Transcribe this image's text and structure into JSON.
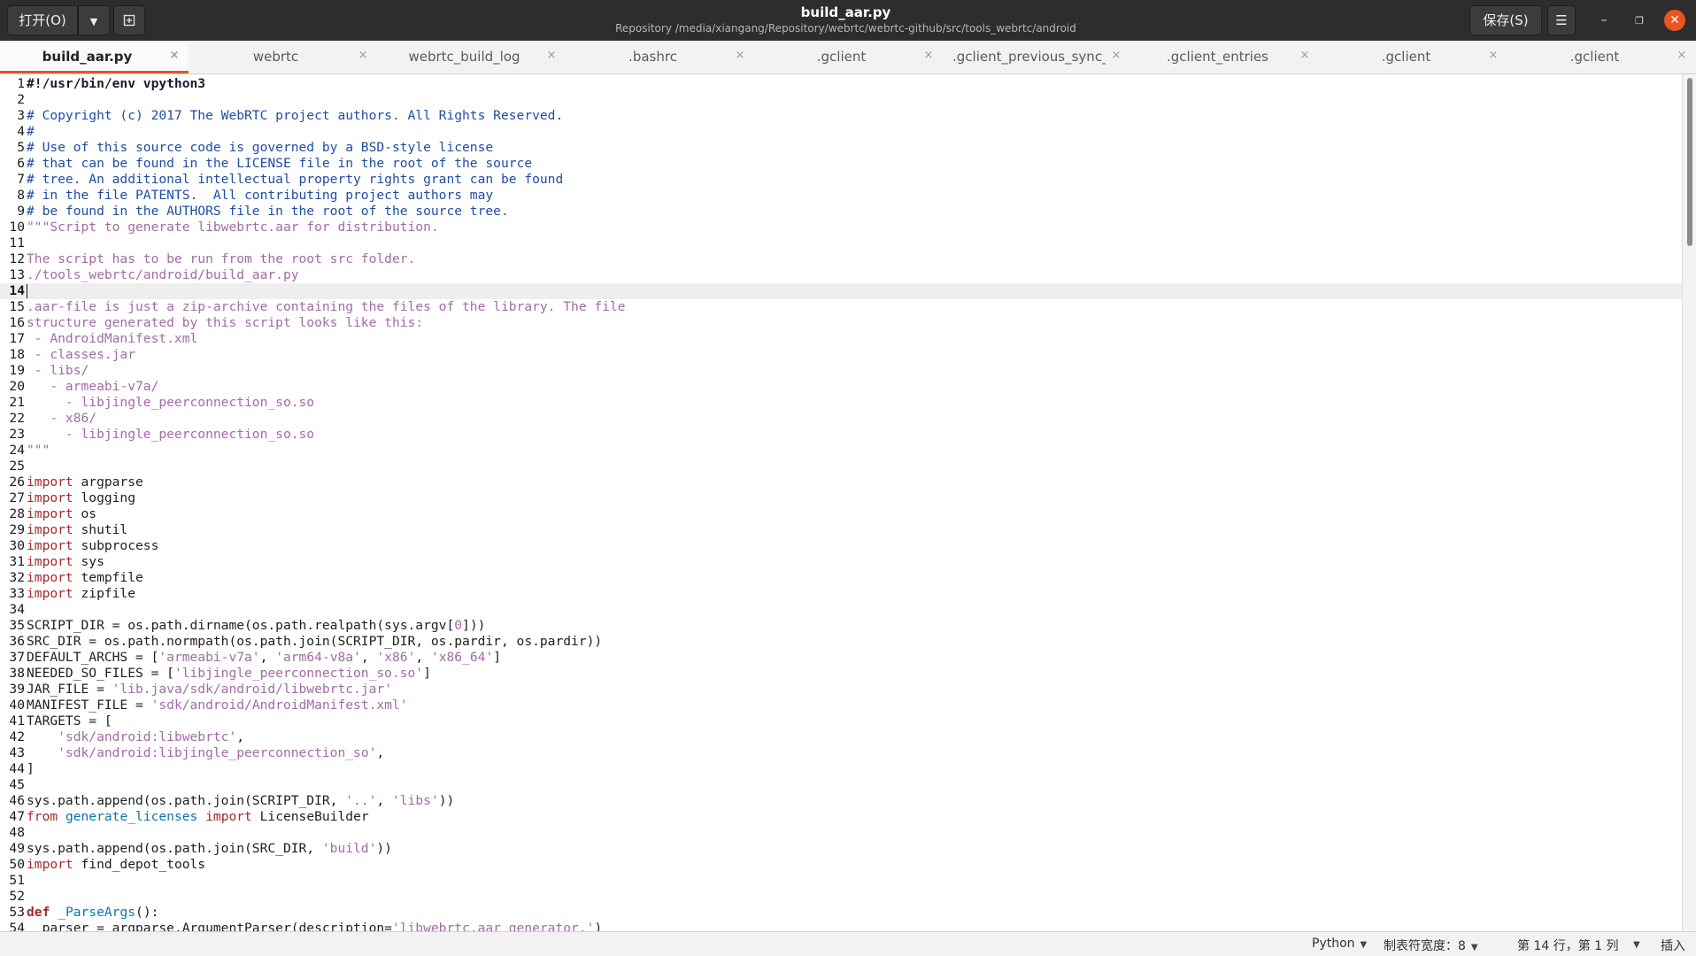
{
  "window": {
    "title": "build_aar.py",
    "subtitle": "Repository /media/xiangang/Repository/webrtc/webrtc-github/src/tools_webrtc/android",
    "open_label": "打开(O)",
    "save_label": "保存(S)",
    "close_color": "#e95420"
  },
  "tabs": [
    {
      "label": "build_aar.py",
      "active": true
    },
    {
      "label": "webrtc"
    },
    {
      "label": "webrtc_build_log"
    },
    {
      "label": ".bashrc"
    },
    {
      "label": ".gclient"
    },
    {
      "label": ".gclient_previous_sync_commits"
    },
    {
      "label": ".gclient_entries"
    },
    {
      "label": ".gclient"
    },
    {
      "label": ".gclient"
    }
  ],
  "editor": {
    "current_line": 14,
    "lines": [
      [
        [
          "shebang",
          "#!/usr/bin/env vpython3"
        ]
      ],
      [],
      [
        [
          "comment",
          "# Copyright (c) 2017 The WebRTC project authors. All Rights Reserved."
        ]
      ],
      [
        [
          "comment",
          "#"
        ]
      ],
      [
        [
          "comment",
          "# Use of this source code is governed by a BSD-style license"
        ]
      ],
      [
        [
          "comment",
          "# that can be found in the LICENSE file in the root of the source"
        ]
      ],
      [
        [
          "comment",
          "# tree. An additional intellectual property rights grant can be found"
        ]
      ],
      [
        [
          "comment",
          "# in the file PATENTS.  All contributing project authors may"
        ]
      ],
      [
        [
          "comment",
          "# be found in the AUTHORS file in the root of the source tree."
        ]
      ],
      [
        [
          "doc",
          "\"\"\"Script to generate libwebrtc.aar for distribution."
        ]
      ],
      [],
      [
        [
          "doc",
          "The script has to be run from the root src folder."
        ]
      ],
      [
        [
          "doc",
          "./tools_webrtc/android/build_aar.py"
        ]
      ],
      [],
      [
        [
          "doc",
          ".aar-file is just a zip-archive containing the files of the library. The file"
        ]
      ],
      [
        [
          "doc",
          "structure generated by this script looks like this:"
        ]
      ],
      [
        [
          "doc",
          " - AndroidManifest.xml"
        ]
      ],
      [
        [
          "doc",
          " - classes.jar"
        ]
      ],
      [
        [
          "doc",
          " - libs/"
        ]
      ],
      [
        [
          "doc",
          "   - armeabi-v7a/"
        ]
      ],
      [
        [
          "doc",
          "     - libjingle_peerconnection_so.so"
        ]
      ],
      [
        [
          "doc",
          "   - x86/"
        ]
      ],
      [
        [
          "doc",
          "     - libjingle_peerconnection_so.so"
        ]
      ],
      [
        [
          "doc",
          "\"\"\""
        ]
      ],
      [],
      [
        [
          "kw",
          "import"
        ],
        [
          "plain",
          " argparse"
        ]
      ],
      [
        [
          "kw",
          "import"
        ],
        [
          "plain",
          " logging"
        ]
      ],
      [
        [
          "kw",
          "import"
        ],
        [
          "plain",
          " os"
        ]
      ],
      [
        [
          "kw",
          "import"
        ],
        [
          "plain",
          " shutil"
        ]
      ],
      [
        [
          "kw",
          "import"
        ],
        [
          "plain",
          " subprocess"
        ]
      ],
      [
        [
          "kw",
          "import"
        ],
        [
          "plain",
          " sys"
        ]
      ],
      [
        [
          "kw",
          "import"
        ],
        [
          "plain",
          " tempfile"
        ]
      ],
      [
        [
          "kw",
          "import"
        ],
        [
          "plain",
          " zipfile"
        ]
      ],
      [],
      [
        [
          "plain",
          "SCRIPT_DIR = os.path.dirname(os.path.realpath(sys.argv["
        ],
        [
          "num",
          "0"
        ],
        [
          "plain",
          "]))"
        ]
      ],
      [
        [
          "plain",
          "SRC_DIR = os.path.normpath(os.path.join(SCRIPT_DIR, os.pardir, os.pardir))"
        ]
      ],
      [
        [
          "plain",
          "DEFAULT_ARCHS = ["
        ],
        [
          "str",
          "'armeabi-v7a'"
        ],
        [
          "plain",
          ", "
        ],
        [
          "str",
          "'arm64-v8a'"
        ],
        [
          "plain",
          ", "
        ],
        [
          "str",
          "'x86'"
        ],
        [
          "plain",
          ", "
        ],
        [
          "str",
          "'x86_64'"
        ],
        [
          "plain",
          "]"
        ]
      ],
      [
        [
          "plain",
          "NEEDED_SO_FILES = ["
        ],
        [
          "str",
          "'libjingle_peerconnection_so.so'"
        ],
        [
          "plain",
          "]"
        ]
      ],
      [
        [
          "plain",
          "JAR_FILE = "
        ],
        [
          "str",
          "'lib.java/sdk/android/libwebrtc.jar'"
        ]
      ],
      [
        [
          "plain",
          "MANIFEST_FILE = "
        ],
        [
          "str",
          "'sdk/android/AndroidManifest.xml'"
        ]
      ],
      [
        [
          "plain",
          "TARGETS = ["
        ]
      ],
      [
        [
          "plain",
          "    "
        ],
        [
          "str",
          "'sdk/android:libwebrtc'"
        ],
        [
          "plain",
          ","
        ]
      ],
      [
        [
          "plain",
          "    "
        ],
        [
          "str",
          "'sdk/android:libjingle_peerconnection_so'"
        ],
        [
          "plain",
          ","
        ]
      ],
      [
        [
          "plain",
          "]"
        ]
      ],
      [],
      [
        [
          "plain",
          "sys.path.append(os.path.join(SCRIPT_DIR, "
        ],
        [
          "str",
          "'..'"
        ],
        [
          "plain",
          ", "
        ],
        [
          "str",
          "'libs'"
        ],
        [
          "plain",
          "))"
        ]
      ],
      [
        [
          "kw",
          "from"
        ],
        [
          "plain",
          " "
        ],
        [
          "mod",
          "generate_licenses"
        ],
        [
          "plain",
          " "
        ],
        [
          "kw",
          "import"
        ],
        [
          "plain",
          " LicenseBuilder"
        ]
      ],
      [],
      [
        [
          "plain",
          "sys.path.append(os.path.join(SRC_DIR, "
        ],
        [
          "str",
          "'build'"
        ],
        [
          "plain",
          "))"
        ]
      ],
      [
        [
          "kw",
          "import"
        ],
        [
          "plain",
          " find_depot_tools"
        ]
      ],
      [],
      [],
      [
        [
          "kwb",
          "def"
        ],
        [
          "plain",
          " "
        ],
        [
          "fn",
          "_ParseArgs"
        ],
        [
          "plain",
          "():"
        ]
      ],
      [
        [
          "plain",
          "  parser = argparse.ArgumentParser(description="
        ],
        [
          "str",
          "'libwebrtc.aar generator.'"
        ],
        [
          "plain",
          ")"
        ]
      ]
    ]
  },
  "statusbar": {
    "language": "Python",
    "tab_width": "制表符宽度：8",
    "position": "第 14 行，第 1 列",
    "mode": "插入"
  }
}
